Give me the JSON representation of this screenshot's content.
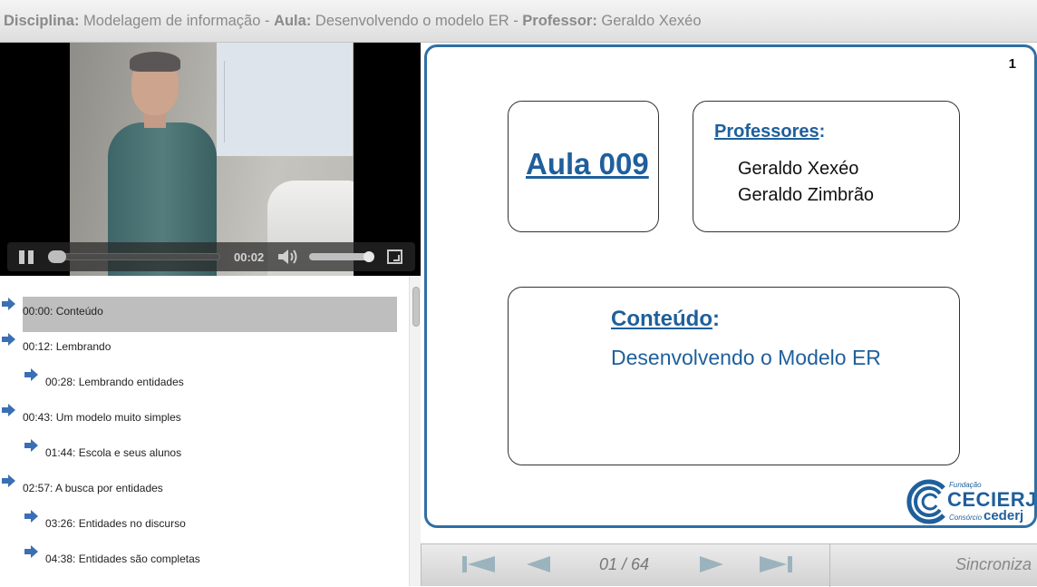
{
  "header": {
    "discipline_label": "Disciplina:",
    "discipline_value": "Modelagem de informação -",
    "lesson_label": "Aula:",
    "lesson_value": "Desenvolvendo o modelo ER -",
    "professor_label": "Professor:",
    "professor_value": "Geraldo Xexéo"
  },
  "player": {
    "time": "00:02",
    "progress": 0.0,
    "volume": 0.9
  },
  "chapters": [
    {
      "label": "00:00: Conteúdo",
      "level": 0,
      "active": true
    },
    {
      "label": "00:12: Lembrando",
      "level": 0,
      "active": false
    },
    {
      "label": "00:28: Lembrando entidades",
      "level": 1,
      "active": false
    },
    {
      "label": "00:43: Um modelo muito simples",
      "level": 0,
      "active": false
    },
    {
      "label": "01:44: Escola e seus alunos",
      "level": 1,
      "active": false
    },
    {
      "label": "02:57: A busca por entidades",
      "level": 0,
      "active": false
    },
    {
      "label": "03:26: Entidades no discurso",
      "level": 1,
      "active": false
    },
    {
      "label": "04:38: Entidades são completas",
      "level": 1,
      "active": false
    }
  ],
  "slide": {
    "number": "1",
    "title": "Aula 009",
    "professors_heading": "Professores",
    "professors_colon": ":",
    "professors": [
      "Geraldo Xexéo",
      "Geraldo Zimbrão"
    ],
    "content_heading": "Conteúdo",
    "content_colon": ":",
    "content_text": "Desenvolvendo o Modelo ER",
    "logo": {
      "fundacao": "Fundação",
      "cecierj": "CECIERJ",
      "consorcio": "Consórcio",
      "cederj": "cederj"
    }
  },
  "navigation": {
    "page_indicator": "01 / 64",
    "sync_label": "Sincroniza"
  },
  "colors": {
    "accent": "#1f5f9c",
    "slide_border": "#2f6fa5",
    "chapter_highlight": "#bebebe",
    "chapter_arrow": "#3a6fb5"
  }
}
